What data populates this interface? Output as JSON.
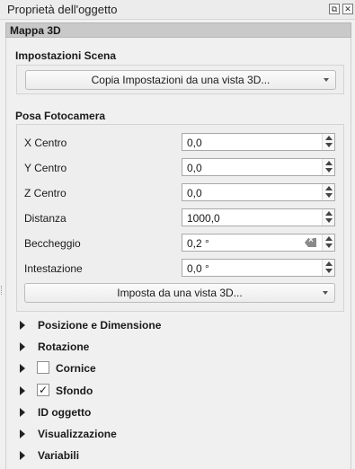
{
  "window": {
    "title": "Proprietà dell'oggetto"
  },
  "panel": {
    "section_title": "Mappa 3D"
  },
  "scene": {
    "group_title": "Impostazioni Scena",
    "copy_button": "Copia Impostazioni da una vista 3D..."
  },
  "camera": {
    "group_title": "Posa Fotocamera",
    "fields": [
      {
        "label": "X Centro",
        "value": "0,0"
      },
      {
        "label": "Y Centro",
        "value": "0,0"
      },
      {
        "label": "Z Centro",
        "value": "0,0"
      },
      {
        "label": "Distanza",
        "value": "1000,0"
      },
      {
        "label": "Beccheggio",
        "value": "0,2 °"
      },
      {
        "label": "Intestazione",
        "value": "0,0 °"
      }
    ],
    "set_button": "Imposta da una vista 3D..."
  },
  "collapsed_groups": [
    {
      "label": "Posizione e Dimensione"
    },
    {
      "label": "Rotazione"
    },
    {
      "label": "Cornice",
      "checkbox": false
    },
    {
      "label": "Sfondo",
      "checkbox": true,
      "check_glyph": "✓"
    },
    {
      "label": "ID oggetto"
    },
    {
      "label": "Visualizzazione"
    },
    {
      "label": "Variabili"
    }
  ]
}
